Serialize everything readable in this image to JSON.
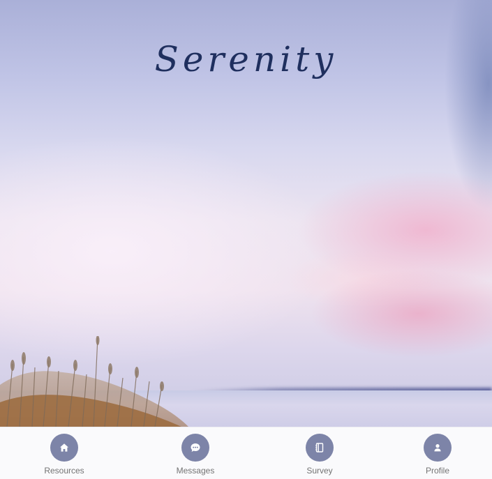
{
  "app": {
    "title": "Serenity"
  },
  "bottom_nav": {
    "items": [
      {
        "label": "Resources",
        "icon": "home-icon"
      },
      {
        "label": "Messages",
        "icon": "chat-bubble-icon"
      },
      {
        "label": "Survey",
        "icon": "notebook-icon"
      },
      {
        "label": "Profile",
        "icon": "person-icon"
      }
    ]
  },
  "colors": {
    "title": "#1f2f5e",
    "nav_icon_bg": "#7d84a8",
    "nav_label": "#737373",
    "nav_bg": "#fafafc"
  }
}
